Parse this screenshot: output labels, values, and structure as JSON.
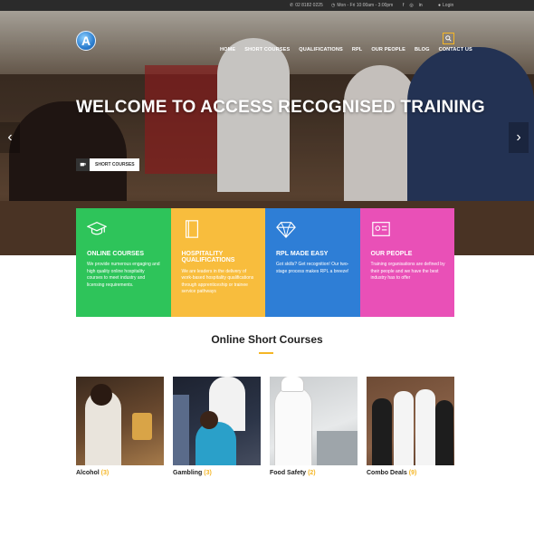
{
  "topbar": {
    "phone": "02 8182 0225",
    "hours": "Mon - Fri 10:00am - 3:00pm",
    "login": "Login",
    "social_icons": [
      "facebook-icon",
      "instagram-icon",
      "linkedin-icon"
    ]
  },
  "header": {
    "logo_letter": "A",
    "nav": [
      "HOME",
      "SHORT COURSES",
      "QUALIFICATIONS",
      "RPL",
      "OUR PEOPLE",
      "BLOG",
      "CONTACT US"
    ]
  },
  "hero": {
    "title": "WELCOME TO ACCESS RECOGNISED TRAINING",
    "button_label": "SHORT COURSES"
  },
  "features": [
    {
      "title": "ONLINE COURSES",
      "text": "We provide numerous engaging and high quality online hospitality courses to meet industry and licensing requirements.",
      "color": "#2ec45a",
      "icon": "graduation-cap-icon"
    },
    {
      "title": "HOSPITALITY QUALIFICATIONS",
      "text": "We are leaders in the delivery of work-based hospitality qualifications through apprenticeship or trainee service pathways",
      "color": "#f8bd3d",
      "icon": "book-icon"
    },
    {
      "title": "RPL MADE EASY",
      "text": "Got skills? Get recognition! Our two-stage process makes RPL a breeze!",
      "color": "#2e7ed6",
      "icon": "diamond-icon"
    },
    {
      "title": "OUR PEOPLE",
      "text": "Training organisations are defined by their people and we have the best industry has to offer",
      "color": "#e950b7",
      "icon": "id-card-icon"
    }
  ],
  "section": {
    "title": "Online Short Courses"
  },
  "courses": [
    {
      "name": "Alcohol",
      "count": "(3)"
    },
    {
      "name": "Gambling",
      "count": "(3)"
    },
    {
      "name": "Food Safety",
      "count": "(2)"
    },
    {
      "name": "Combo Deals",
      "count": "(9)"
    }
  ],
  "colors": {
    "accent": "#f5b625",
    "topbar": "#2b2b2b"
  }
}
